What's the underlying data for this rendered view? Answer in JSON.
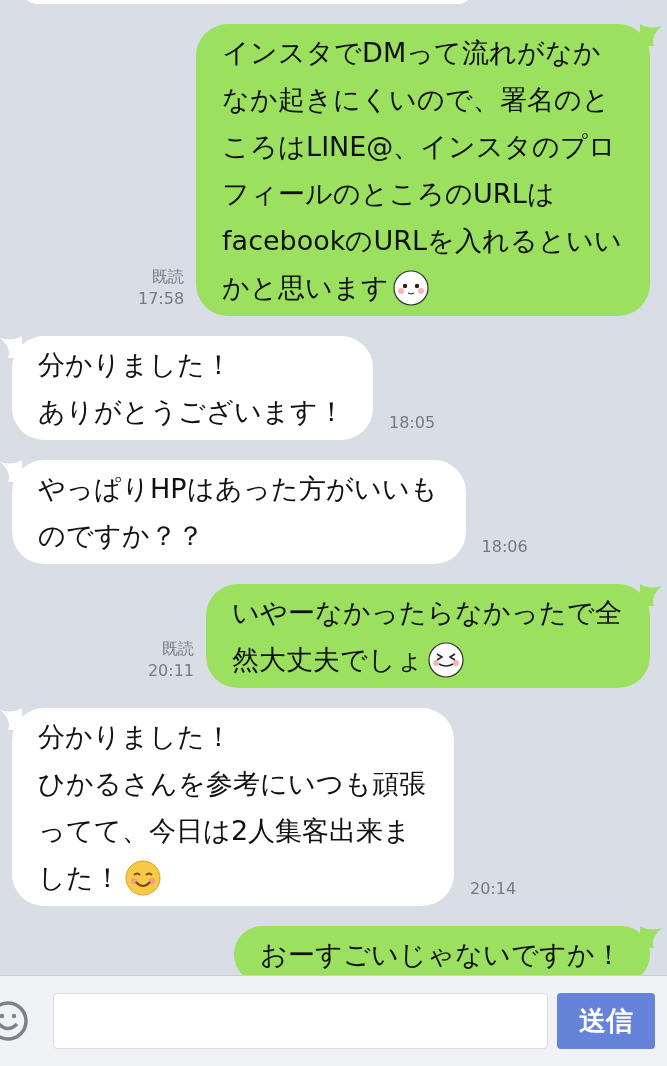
{
  "messages": [
    {
      "kind": "sent",
      "lines": [
        "インスタでDMって流れがなか",
        "なか起きにくいので、署名のと",
        "ころはLINE@、インスタのプロ",
        "フィールのところのURLは",
        "facebookのURLを入れるといい",
        "かと思います"
      ],
      "emoji": {
        "kind": "sticker-calm"
      },
      "read": "既読",
      "time": "17:58"
    },
    {
      "kind": "received",
      "lines": [
        "分かりました！",
        "ありがとうございます！"
      ],
      "time": "18:05"
    },
    {
      "kind": "received",
      "lines": [
        "やっぱりHPはあった方がいいも",
        "のですか？？"
      ],
      "time": "18:06"
    },
    {
      "kind": "sent",
      "lines": [
        "いやーなかったらなかったで全",
        "然大丈夫でしょ"
      ],
      "emoji": {
        "kind": "sticker-laugh"
      },
      "read": "既読",
      "time": "20:11"
    },
    {
      "kind": "received",
      "lines": [
        "分かりました！",
        "ひかるさんを参考にいつも頑張",
        "ってて、今日は2人集客出来ま",
        "した！"
      ],
      "emoji": {
        "kind": "smile"
      },
      "time": "20:14"
    },
    {
      "kind": "sent",
      "lines": [
        "おーすごいじゃないですか！"
      ]
    }
  ],
  "composer": {
    "send_button": "送信"
  }
}
